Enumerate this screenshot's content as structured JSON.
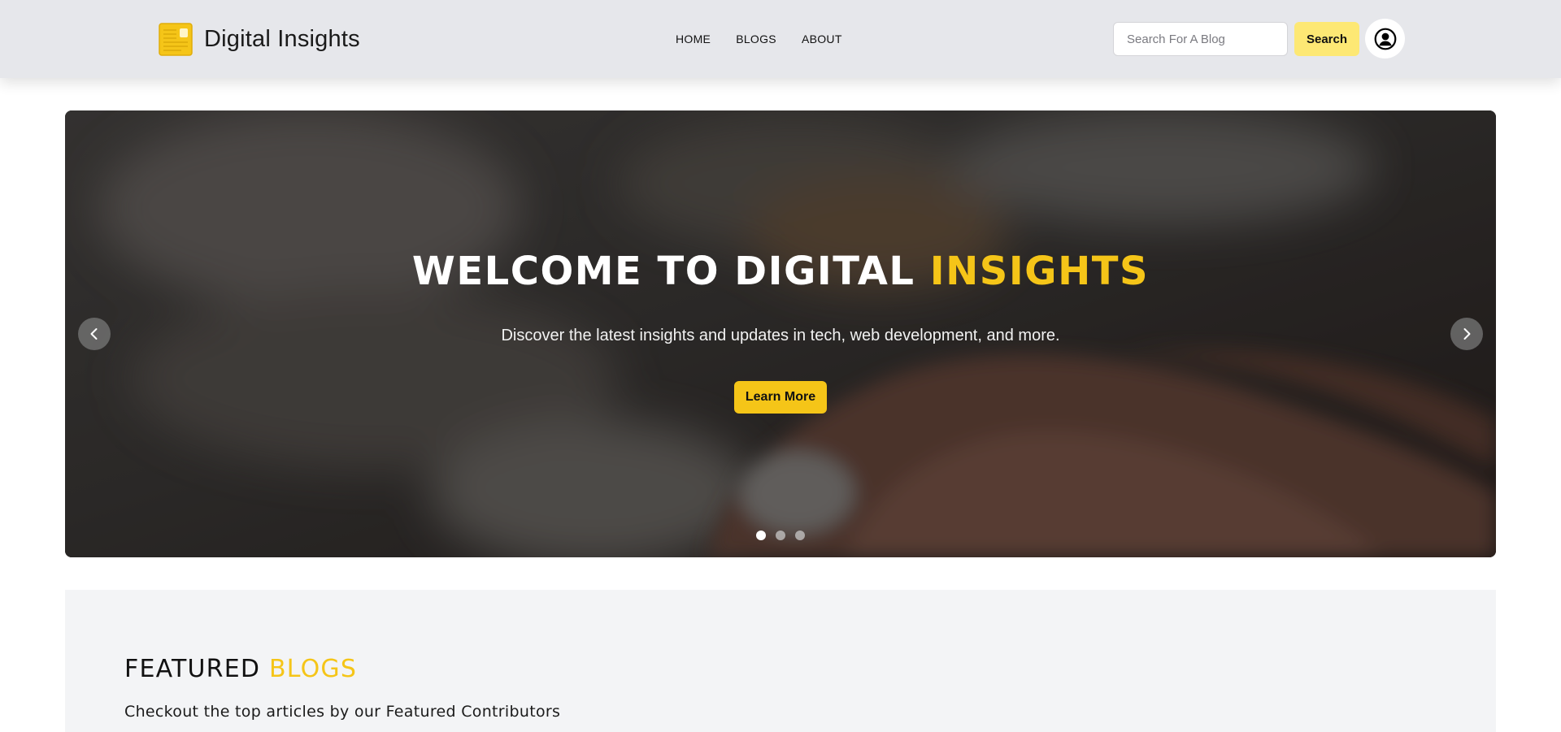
{
  "navbar": {
    "brand_name": "Digital Insights",
    "links": [
      {
        "label": "HOME"
      },
      {
        "label": "BLOGS"
      },
      {
        "label": "ABOUT"
      }
    ],
    "search": {
      "placeholder": "Search For A Blog",
      "value": "",
      "button_label": "Search"
    },
    "profile_icon": "user-circle-icon"
  },
  "hero": {
    "title_main": "WELCOME TO DIGITAL ",
    "title_accent": "INSIGHTS",
    "subtitle": "Discover the latest insights and updates in tech, web development, and more.",
    "cta_label": "Learn More",
    "prev_icon": "chevron-left-icon",
    "next_icon": "chevron-right-icon",
    "slides_total": 3,
    "active_slide": 1
  },
  "featured": {
    "title_main": "FEATURED ",
    "title_accent": "BLOGS",
    "subtitle": "Checkout the top articles by our Featured Contributors"
  },
  "colors": {
    "accent": "#f5c518",
    "search_button": "#fde874",
    "navbar_bg": "#e6e7eb",
    "section_bg": "#f3f4f6"
  }
}
